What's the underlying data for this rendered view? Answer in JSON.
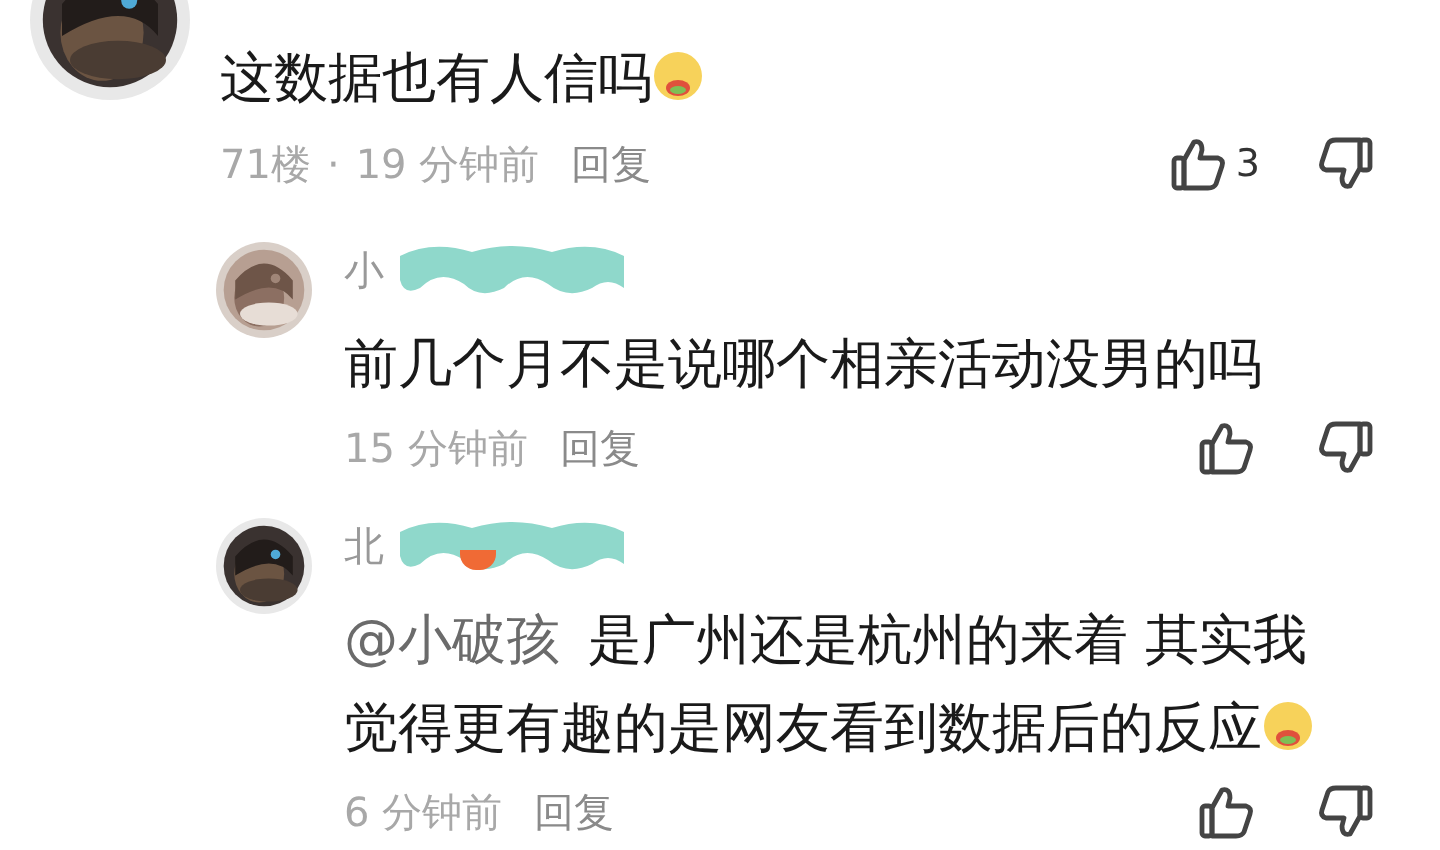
{
  "comment": {
    "text": "这数据也有人信吗",
    "emoji": true,
    "floor": "71楼",
    "separator": "·",
    "time": "19 分钟前",
    "reply": "回复",
    "likes": "3",
    "replies": [
      {
        "name": "小",
        "redacted": true,
        "badge": false,
        "text": "前几个月不是说哪个相亲活动没男的吗",
        "emoji": false,
        "time": "15 分钟前",
        "reply": "回复"
      },
      {
        "name": "北",
        "redacted": true,
        "badge": true,
        "mention": "@小破孩",
        "text": "是广州还是杭州的来着 其实我觉得更有趣的是网友看到数据后的反应",
        "emoji": true,
        "time": "6 分钟前",
        "reply": "回复"
      }
    ]
  }
}
